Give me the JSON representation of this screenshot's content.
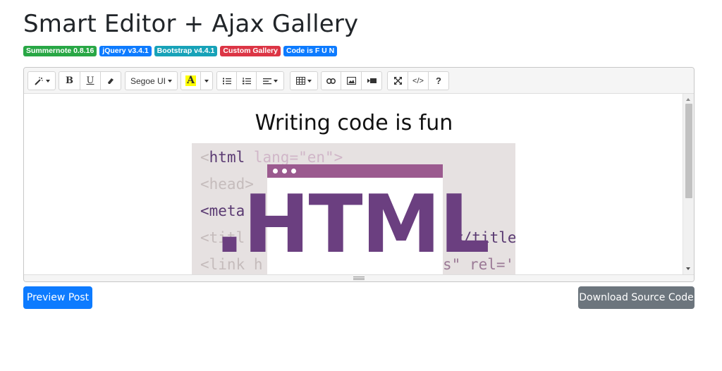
{
  "page": {
    "title": "Smart Editor + Ajax Gallery"
  },
  "badges": [
    {
      "label": "Summernote 0.8.16",
      "color": "#28a745"
    },
    {
      "label": "jQuery v3.4.1",
      "color": "#0d7bff"
    },
    {
      "label": "Bootstrap v4.4.1",
      "color": "#17a2b8"
    },
    {
      "label": "Custom Gallery",
      "color": "#dc3545"
    },
    {
      "label": "Code is F U N",
      "color": "#0d7bff"
    }
  ],
  "toolbar": {
    "style_icon": "magic-wand-icon",
    "bold_label": "B",
    "underline_label": "U",
    "clear_format_icon": "eraser-icon",
    "font_name": "Segoe UI",
    "color_letter": "A",
    "color_highlight": "#ffff00",
    "unordered_list_icon": "unordered-list-icon",
    "ordered_list_icon": "ordered-list-icon",
    "paragraph_icon": "align-left-icon",
    "table_icon": "table-icon",
    "link_icon": "link-icon",
    "picture_icon": "picture-icon",
    "video_icon": "video-icon",
    "fullscreen_icon": "fullscreen-icon",
    "codeview_label": "</>",
    "help_label": "?"
  },
  "content": {
    "heading": "Writing  code is fun",
    "image": {
      "code_lines": [
        {
          "tag": "<",
          "name": "html",
          "rest": " lang=\"en\">"
        },
        {
          "tag": "",
          "name": "",
          "rest": "<head>"
        },
        {
          "tag": "<",
          "name": "meta",
          "rest": ""
        },
        {
          "tag": "",
          "name": "",
          "rest": "<titl"
        },
        {
          "tag": "",
          "name": "",
          "rest": "<link h"
        },
        {
          "tag": "",
          "name": "",
          "rest": "</title"
        },
        {
          "tag": "",
          "name": "",
          "rest": "s\"  rel='"
        }
      ],
      "big_text": ".HTML"
    }
  },
  "buttons": {
    "preview": "Preview Post",
    "download": "Download Source Code"
  }
}
